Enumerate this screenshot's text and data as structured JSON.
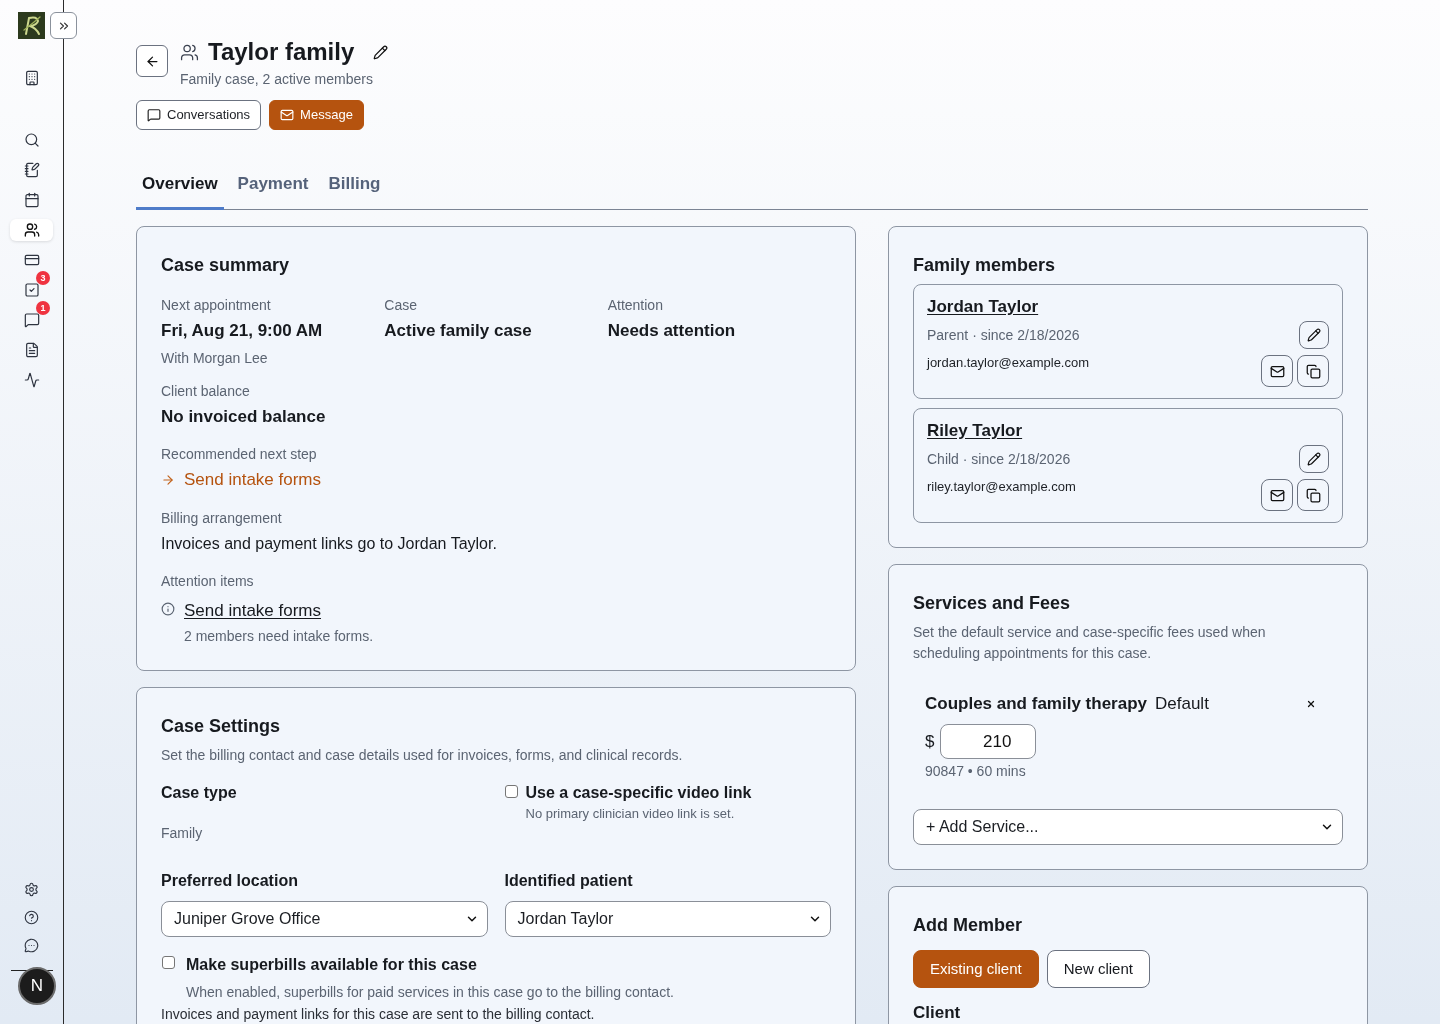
{
  "sidebar": {
    "items": [
      {
        "selected": false
      },
      {
        "selected": false
      },
      {
        "selected": false
      },
      {
        "selected": false
      },
      {
        "selected": true
      },
      {
        "selected": false
      },
      {
        "selected": false,
        "badge": "3"
      },
      {
        "selected": false,
        "badge": "1"
      },
      {
        "selected": false
      },
      {
        "selected": false
      }
    ],
    "avatar": {
      "initial": "N"
    }
  },
  "header": {
    "title": "Taylor family",
    "subtitle": "Family case, 2 active members",
    "buttons": [
      {
        "label": "Conversations",
        "kind": "secondary"
      },
      {
        "label": "Message",
        "kind": "primary"
      }
    ]
  },
  "tabs": [
    {
      "label": "Overview",
      "selected": true
    },
    {
      "label": "Payment",
      "selected": false
    },
    {
      "label": "Billing",
      "selected": false
    }
  ],
  "case_summary": {
    "title": "Case summary",
    "facts": [
      {
        "label": "Next appointment",
        "value": "Fri, Aug 21, 9:00 AM",
        "note": "With Morgan Lee"
      },
      {
        "label": "Case",
        "value": "Active family case"
      },
      {
        "label": "Attention",
        "value": "Needs attention"
      }
    ],
    "client_balance": {
      "label": "Client balance",
      "value": "No invoiced balance"
    },
    "next_step": {
      "label": "Recommended next step",
      "link": "Send intake forms"
    },
    "billing_arrangement": {
      "label": "Billing arrangement",
      "text": "Invoices and payment links go to Jordan Taylor."
    },
    "attention_items": {
      "label": "Attention items",
      "items": [
        {
          "title": "Send intake forms",
          "detail": "2 members need intake forms."
        }
      ]
    }
  },
  "case_settings": {
    "title": "Case Settings",
    "description": "Set the billing contact and case details used for invoices, forms, and clinical records.",
    "case_type": {
      "label": "Case type",
      "value": "Family"
    },
    "video_link": {
      "label": "Use a case-specific video link",
      "note": "No primary clinician video link is set.",
      "checked": false
    },
    "preferred_location": {
      "label": "Preferred location",
      "value": "Juniper Grove Office"
    },
    "identified_patient": {
      "label": "Identified patient",
      "value": "Jordan Taylor"
    },
    "superbills": {
      "label": "Make superbills available for this case",
      "note": "When enabled, superbills for paid services in this case go to the billing contact.",
      "checked": false
    },
    "footer_note": "Invoices and payment links for this case are sent to the billing contact."
  },
  "family_members": {
    "title": "Family members",
    "members": [
      {
        "name": "Jordan Taylor",
        "role": "Parent · since 2/18/2026",
        "email": "jordan.taylor@example.com"
      },
      {
        "name": "Riley Taylor",
        "role": "Child · since 2/18/2026",
        "email": "riley.taylor@example.com"
      }
    ]
  },
  "services": {
    "title": "Services and Fees",
    "description": "Set the default service and case-specific fees used when scheduling appointments for this case.",
    "items": [
      {
        "name": "Couples and family therapy",
        "tag": "Default",
        "currency": "$",
        "fee": "210",
        "details": "90847 • 60 mins"
      }
    ],
    "add_select": {
      "value": "+ Add Service..."
    }
  },
  "add_member": {
    "title": "Add Member",
    "modes": [
      {
        "label": "Existing client",
        "selected": true
      },
      {
        "label": "New client",
        "selected": false
      }
    ],
    "client_label": "Client"
  }
}
